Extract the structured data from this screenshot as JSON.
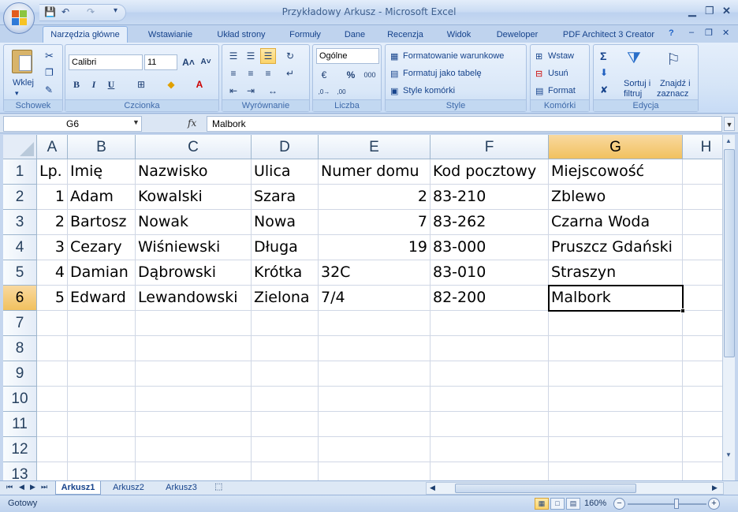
{
  "window": {
    "title": "Przykładowy Arkusz - Microsoft Excel",
    "minimize_icon": "minimize-icon",
    "maximize_icon": "maximize-icon",
    "close_icon": "close-icon"
  },
  "quick_access": {
    "save": "💾",
    "undo": "↶",
    "redo": "↷",
    "customize": "▾"
  },
  "tabs": [
    {
      "label": "Narzędzia główne",
      "active": true
    },
    {
      "label": "Wstawianie"
    },
    {
      "label": "Układ strony"
    },
    {
      "label": "Formuły"
    },
    {
      "label": "Dane"
    },
    {
      "label": "Recenzja"
    },
    {
      "label": "Widok"
    },
    {
      "label": "Deweloper"
    },
    {
      "label": "PDF Architect 3 Creator"
    }
  ],
  "ribbon": {
    "clipboard": {
      "label": "Schowek",
      "paste": "Wklej"
    },
    "font": {
      "label": "Czcionka",
      "name": "Calibri",
      "size": "11",
      "bold": "B",
      "italic": "I",
      "underline": "U"
    },
    "alignment": {
      "label": "Wyrównanie"
    },
    "number": {
      "label": "Liczba",
      "format": "Ogólne",
      "percent": "%",
      "thousands": "000"
    },
    "styles": {
      "label": "Style",
      "conditional": "Formatowanie warunkowe",
      "as_table": "Formatuj jako tabelę",
      "cell_styles": "Style komórki"
    },
    "cells": {
      "label": "Komórki",
      "insert": "Wstaw",
      "delete": "Usuń",
      "format": "Format"
    },
    "editing": {
      "label": "Edycja",
      "sort_1": "Sortuj i",
      "sort_2": "filtruj",
      "find_1": "Znajdź i",
      "find_2": "zaznacz"
    }
  },
  "formula_bar": {
    "name_box": "G6",
    "fx": "fx",
    "value": "Malbork"
  },
  "columns": [
    "A",
    "B",
    "C",
    "D",
    "E",
    "F",
    "G",
    "H"
  ],
  "rows": [
    "1",
    "2",
    "3",
    "4",
    "5",
    "6",
    "7",
    "8",
    "9",
    "10",
    "11",
    "12",
    "13"
  ],
  "cells": [
    [
      "Lp.",
      "Imię",
      "Nazwisko",
      "Ulica",
      "Numer domu",
      "Kod pocztowy",
      "Miejscowość"
    ],
    [
      "1",
      "Adam",
      "Kowalski",
      "Szara",
      "2",
      "83-210",
      "Zblewo"
    ],
    [
      "2",
      "Bartosz",
      "Nowak",
      "Nowa",
      "7",
      "83-262",
      "Czarna Woda"
    ],
    [
      "3",
      "Cezary",
      "Wiśniewski",
      "Długa",
      "19",
      "83-000",
      "Pruszcz Gdański"
    ],
    [
      "4",
      "Damian",
      "Dąbrowski",
      "Krótka",
      "32C",
      "83-010",
      "Straszyn"
    ],
    [
      "5",
      "Edward",
      "Lewandowski",
      "Zielona",
      "7/4",
      "82-200",
      "Malbork"
    ]
  ],
  "sheets": [
    {
      "label": "Arkusz1",
      "active": true
    },
    {
      "label": "Arkusz2"
    },
    {
      "label": "Arkusz3"
    }
  ],
  "status": {
    "ready": "Gotowy",
    "zoom": "160%",
    "zoom_level": 0.62
  },
  "colors": {
    "accent": "#15428b",
    "selected_header": "#f1c15f"
  }
}
